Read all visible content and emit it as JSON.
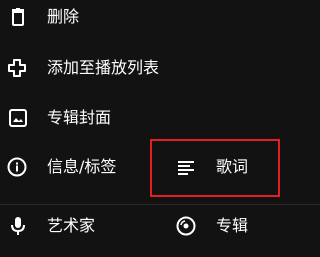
{
  "menu": {
    "items": [
      {
        "label": "删除",
        "icon": "trash-icon"
      },
      {
        "label": "添加至播放列表",
        "icon": "plus-icon"
      },
      {
        "label": "专辑封面",
        "icon": "image-icon"
      },
      {
        "label": "信息/标签",
        "icon": "info-icon"
      },
      {
        "label": "歌词",
        "icon": "lyrics-icon"
      },
      {
        "label": "艺术家",
        "icon": "microphone-icon"
      },
      {
        "label": "专辑",
        "icon": "album-disc-icon"
      }
    ]
  },
  "colors": {
    "background": "#121212",
    "text": "#ffffff",
    "highlight": "#e0211f"
  }
}
